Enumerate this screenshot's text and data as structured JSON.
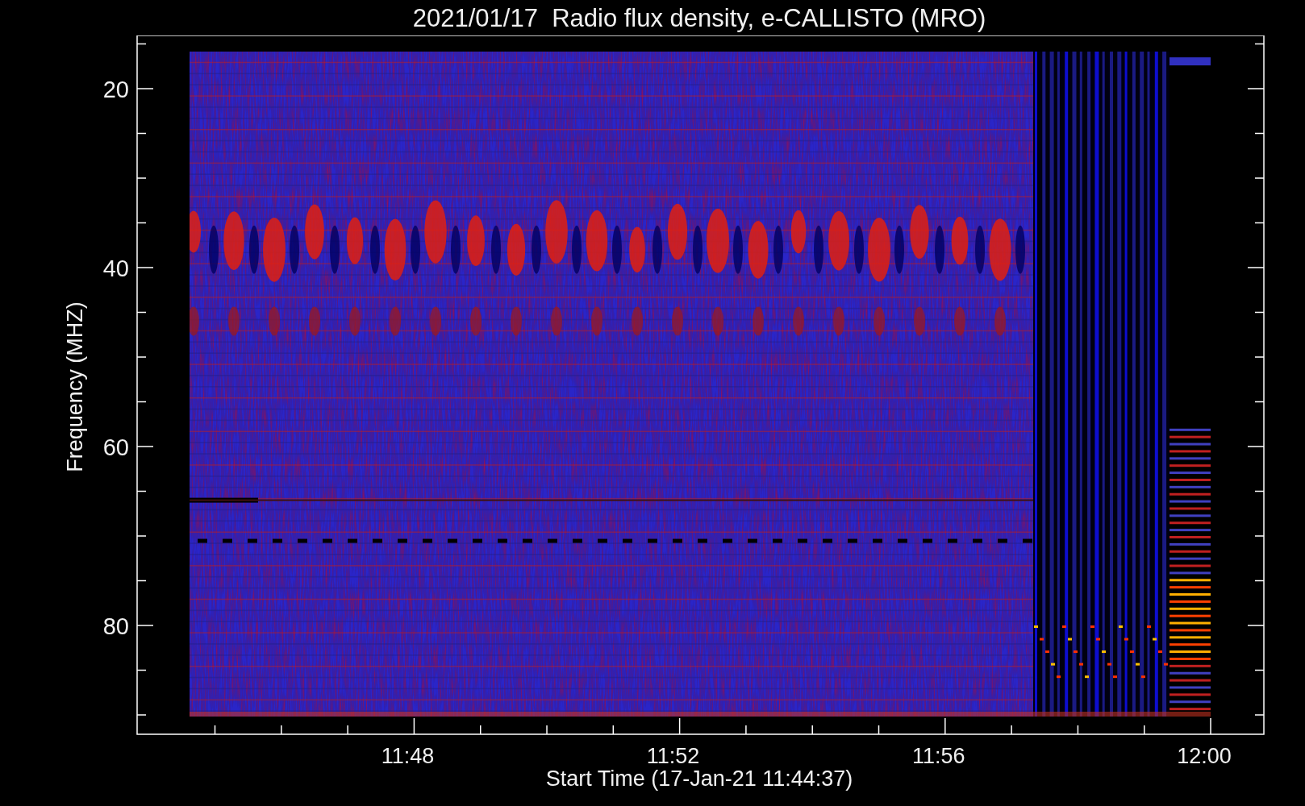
{
  "title": "2021/01/17  Radio flux density, e-CALLISTO (MRO)",
  "plot": {
    "ylabel": "Frequency (MHZ)",
    "xlabel": "Start Time (17-Jan-21 11:44:37)",
    "yticks": [
      "20",
      "40",
      "60",
      "80"
    ],
    "xticks": [
      "11:48",
      "11:52",
      "11:56",
      "12:00"
    ]
  }
}
